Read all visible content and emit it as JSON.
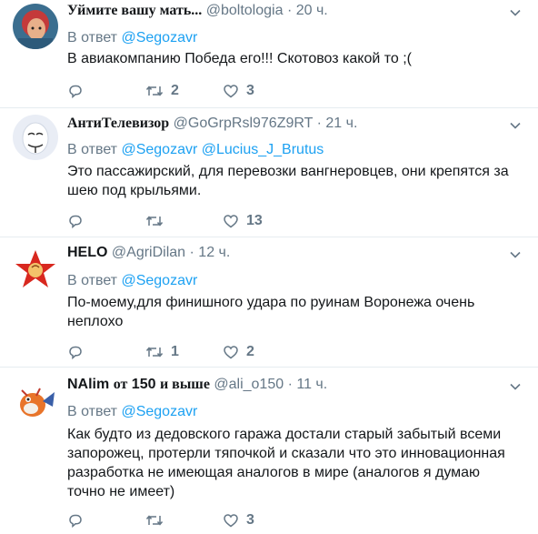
{
  "reply_prefix": "В ответ",
  "tweets": [
    {
      "name": "Уймите вашу мать...",
      "handle": "@boltologia",
      "time": "20 ч.",
      "mentions": [
        "@Segozavr"
      ],
      "text": "В авиакомпанию Победа его!!! Скотовоз какой то ;(",
      "retweets": "2",
      "likes": "3"
    },
    {
      "name": "АнтиТелевизор",
      "handle": "@GoGrpRsl976Z9RT",
      "time": "21 ч.",
      "mentions": [
        "@Segozavr",
        "@Lucius_J_Brutus"
      ],
      "text": "Это пассажирский, для перевозки вангнеровцев, они крепятся за шею под крыльями.",
      "retweets": "",
      "likes": "13"
    },
    {
      "name": "HELO",
      "handle": "@AgriDilan",
      "time": "12 ч.",
      "mentions": [
        "@Segozavr"
      ],
      "text": "По-моему,для финишного удара по руинам Воронежа очень неплохо",
      "retweets": "1",
      "likes": "2"
    },
    {
      "name_parts": [
        "NAlim",
        "от",
        "150",
        "и выше"
      ],
      "handle": "@ali_o150",
      "time": "11 ч.",
      "mentions": [
        "@Segozavr"
      ],
      "text": "Как будто из дедовского гаража достали старый забытый всеми запорожец, протерли тяпочкой и сказали что это инновационная разработка не имеющая аналогов в мире (аналогов я думаю точно не имеет)",
      "retweets": "",
      "likes": "3"
    }
  ],
  "colors": {
    "link": "#1da1f2",
    "muted": "#657786",
    "text": "#14171a",
    "divider": "#e6ecf0"
  },
  "icons": [
    "reply-icon",
    "retweet-icon",
    "like-icon",
    "caret-down-icon"
  ]
}
